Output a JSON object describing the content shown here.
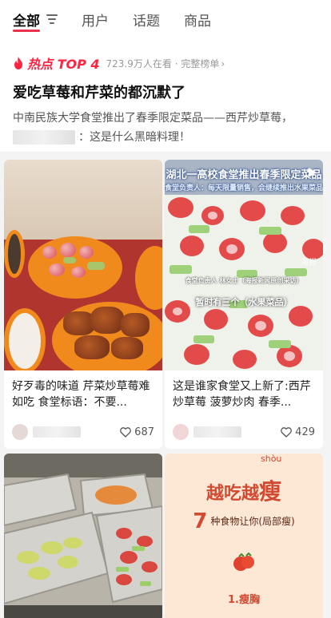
{
  "tabs": [
    {
      "label": "全部"
    },
    {
      "label": "用户"
    },
    {
      "label": "话题"
    },
    {
      "label": "商品"
    }
  ],
  "hot": {
    "label": "热点 TOP 4",
    "meta": "723.9万人在看 · 完整榜单",
    "title": "爱吃草莓和芹菜的都沉默了",
    "desc_line1": "中南民族大学食堂推出了春季限定菜品——西芹炒草莓，",
    "desc_line2": "：这是什么黑暗料理！"
  },
  "cards": [
    {
      "title": "好歹毒的味道 芹菜炒草莓难如吃 食堂标语：不要...",
      "likes": "687"
    },
    {
      "title": "这是谁家食堂又上新了:西芹炒草莓 菠萝炒肉 春季...",
      "likes": "429"
    }
  ],
  "img2": {
    "caption_top": "湖北一高校食堂推出春季限定菜品",
    "caption_sub": "食堂负责人：每天限量销售，会继续推出水果菜品",
    "caption_small": "食堂负责人 林女士（海报新闻原创采访）",
    "caption_bottom": "暂时有三个（水果菜品）",
    "watermark": "海报"
  },
  "img4": {
    "pinyin": "shòu",
    "title_a": "越吃越",
    "title_b": "瘦",
    "num": "7",
    "sub": "种食物让你(局部瘦)",
    "item": "1.瘦胸"
  },
  "colors": {
    "accent": "#ff2442",
    "hot": "#ff2442"
  }
}
